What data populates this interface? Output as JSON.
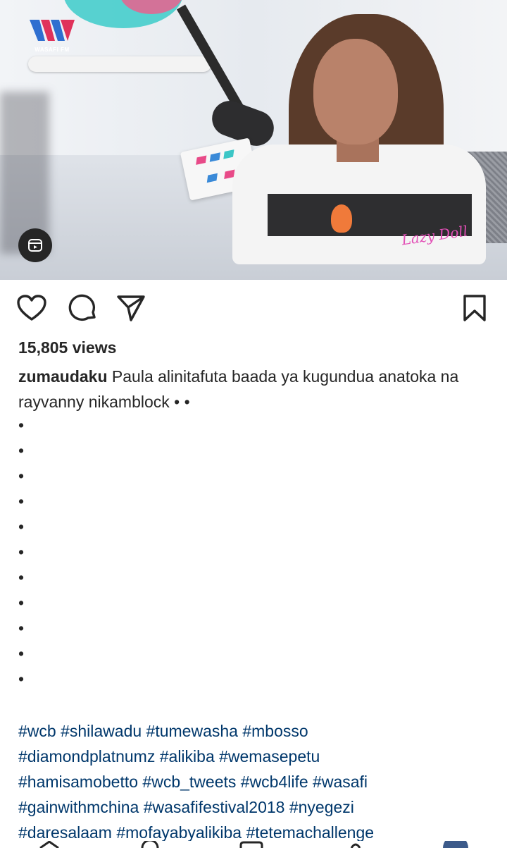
{
  "media": {
    "logo_text": "WASAFI FM",
    "watermark": "Lazy Doll",
    "reels_icon": "reels-icon"
  },
  "actions": {
    "like_icon": "heart-icon",
    "comment_icon": "comment-icon",
    "share_icon": "send-icon",
    "save_icon": "bookmark-icon"
  },
  "post": {
    "views": "15,805 views",
    "username": "zumaudaku",
    "caption": "Paula alinitafuta baada ya kugundua anatoka na rayvanny nikamblock • •",
    "bullets": [
      "•",
      "•",
      "•",
      "•",
      "•",
      "•",
      "•",
      "•",
      "•",
      "•",
      "•"
    ],
    "hashtag_lines": [
      "#wcb #shilawadu  #tumewasha #mbosso",
      "#diamondplatnumz #alikiba #wemasepetu",
      "#hamisamobetto #wcb_tweets #wcb4life #wasafi",
      "#gainwithmchina #wasafifestival2018 #nyegezi",
      "#daresalaam #mofayabyalikiba  #tetemachallenge"
    ]
  },
  "colors": {
    "text": "#262626",
    "hashtag": "#00376b"
  }
}
